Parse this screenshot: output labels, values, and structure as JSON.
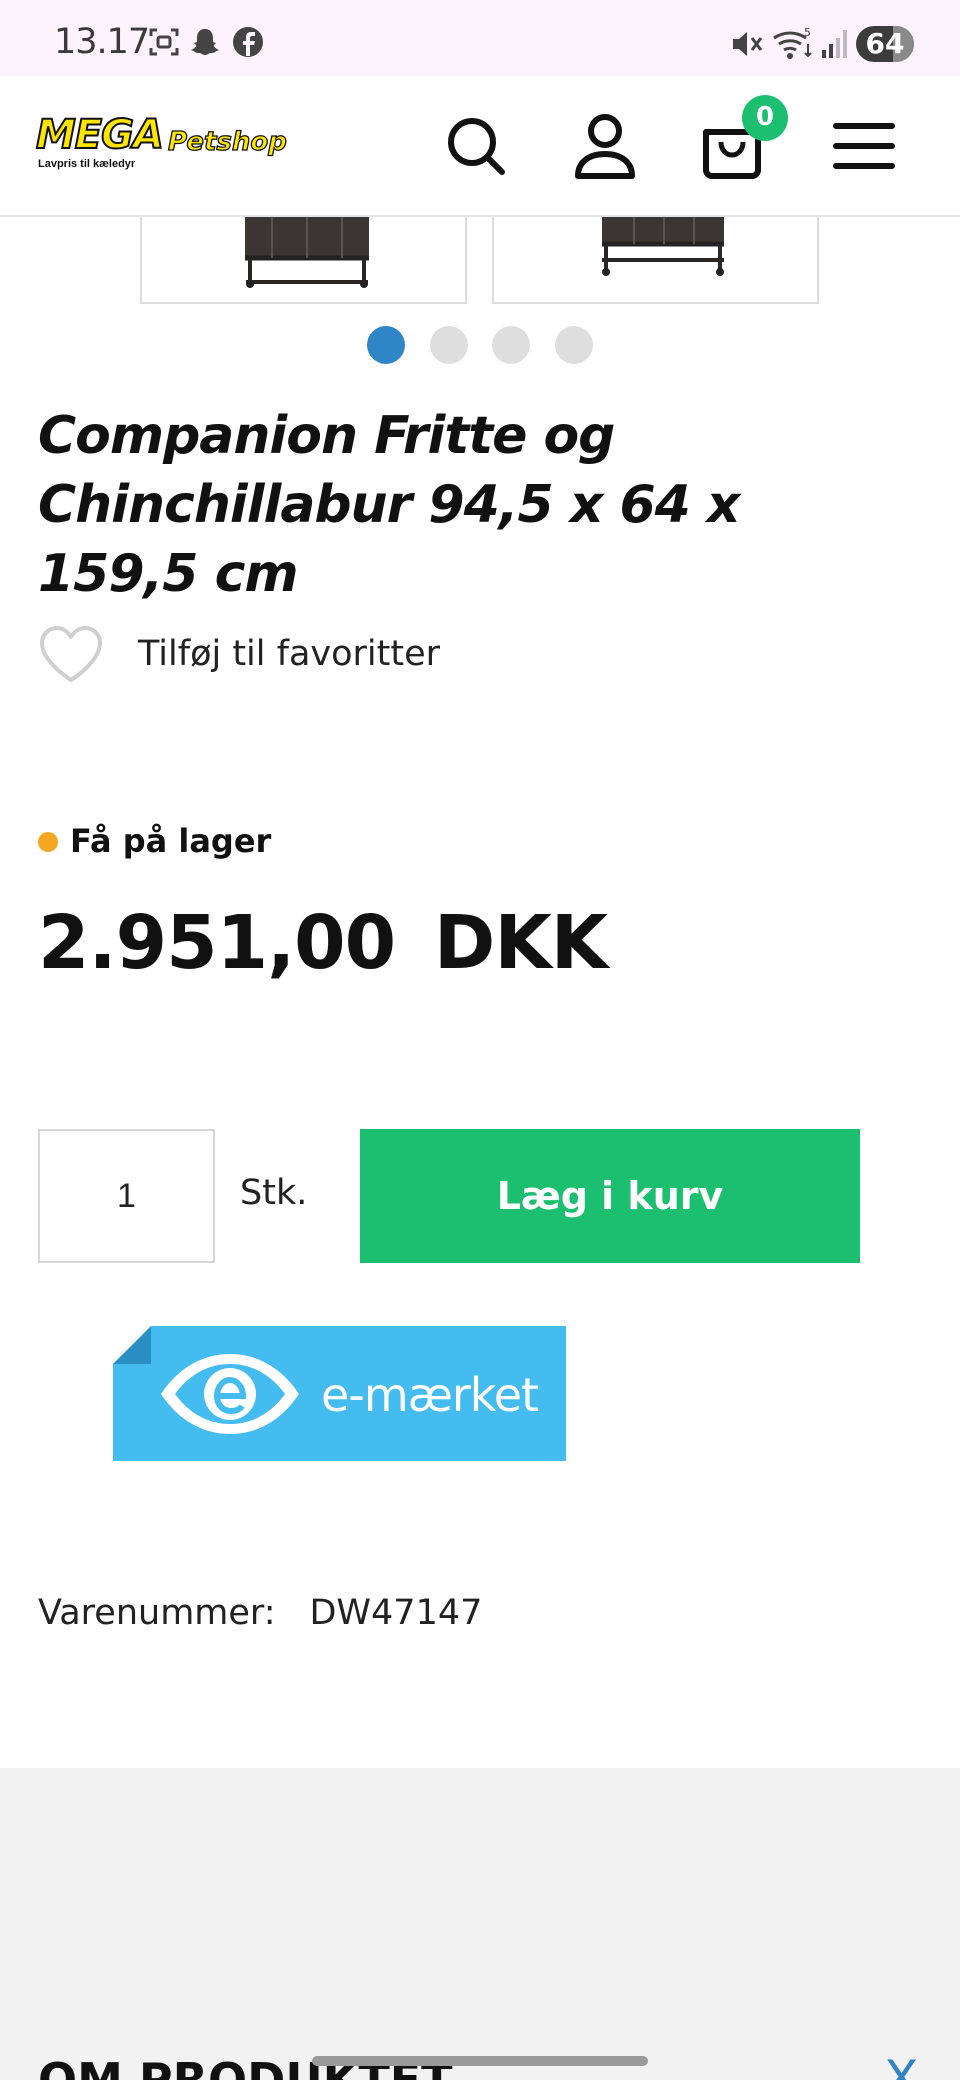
{
  "status_bar": {
    "time": "13.17",
    "battery": "64",
    "battery_level": 0.64
  },
  "header": {
    "logo_main": "MEGA",
    "logo_sub": "Petshop",
    "logo_tagline": "Lavpris til kæledyr",
    "cart_count": "0",
    "icons": [
      "search-icon",
      "account-icon",
      "cart-icon",
      "menu-icon"
    ],
    "accent_color": "#1bbf6f"
  },
  "gallery": {
    "image_count": 4,
    "active_index": 0,
    "active_dot_color": "#2f86c6"
  },
  "product": {
    "title": "Companion Fritte og Chinchillabur 94,5 x 64 x 159,5 cm",
    "favorite_label": "Tilføj til favoritter",
    "stock_status": "Få på lager",
    "stock_color": "#f5a623",
    "price": "2.951,00 DKK",
    "quantity": "1",
    "unit": "Stk.",
    "add_to_cart": "Læg i kurv",
    "badge_text": "e-mærket",
    "sku_label": "Varenummer:",
    "sku_value": "DW47147"
  },
  "about": {
    "title": "OM PRODUKTET",
    "toggle": "X"
  }
}
